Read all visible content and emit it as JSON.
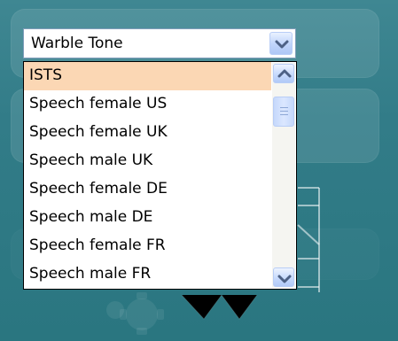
{
  "combo": {
    "value": "Warble Tone",
    "dropdown_icon": "chevron-down-icon"
  },
  "dropdown": {
    "selected_index": 0,
    "items": [
      {
        "label": "ISTS"
      },
      {
        "label": "Speech female US"
      },
      {
        "label": "Speech female UK"
      },
      {
        "label": "Speech male UK"
      },
      {
        "label": "Speech female DE"
      },
      {
        "label": "Speech male DE"
      },
      {
        "label": "Speech female FR"
      },
      {
        "label": "Speech male FR"
      }
    ],
    "scrollbar": {
      "up_icon": "chevron-up-icon",
      "down_icon": "chevron-down-icon",
      "thumb_grip_icon": "grip-lines-icon"
    }
  },
  "colors": {
    "background": "#327c88",
    "selection": "#fbd7b4",
    "chevron": "#4d6185"
  }
}
